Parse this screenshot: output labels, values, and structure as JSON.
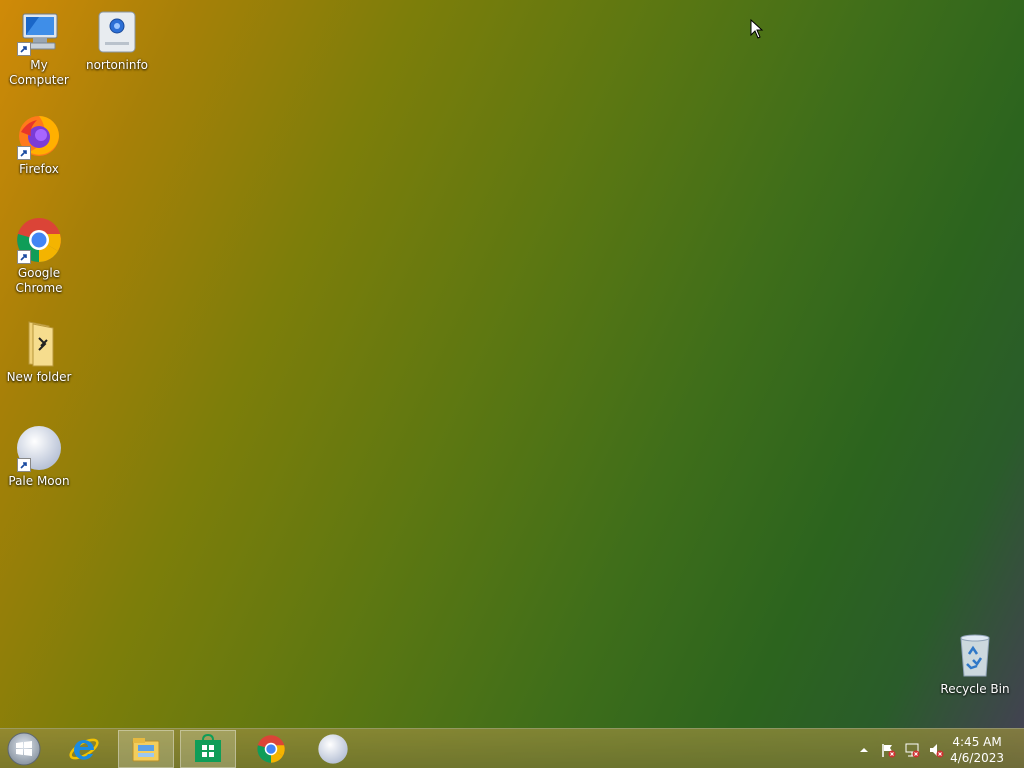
{
  "desktop": {
    "icons": [
      {
        "label": "My Computer",
        "icon": "computer-icon"
      },
      {
        "label": "nortoninfo",
        "icon": "norton-drive-icon"
      },
      {
        "label": "Firefox",
        "icon": "firefox-icon"
      },
      {
        "label": "Google Chrome",
        "icon": "chrome-icon"
      },
      {
        "label": "New folder",
        "icon": "folder-icon"
      },
      {
        "label": "Pale Moon",
        "icon": "pale-moon-icon"
      },
      {
        "label": "Recycle Bin",
        "icon": "recycle-bin-icon"
      }
    ]
  },
  "taskbar": {
    "start": {
      "icon": "windows-logo-icon"
    },
    "pinned": [
      {
        "icon": "internet-explorer-icon"
      },
      {
        "icon": "file-explorer-icon"
      },
      {
        "icon": "store-icon"
      },
      {
        "icon": "chrome-icon"
      },
      {
        "icon": "pale-moon-icon"
      }
    ],
    "tray": {
      "icons": [
        "show-hidden-icons-icon",
        "action-center-flag-icon",
        "network-icon",
        "volume-muted-icon"
      ],
      "time": "4:45 AM",
      "date": "4/6/2023"
    }
  }
}
